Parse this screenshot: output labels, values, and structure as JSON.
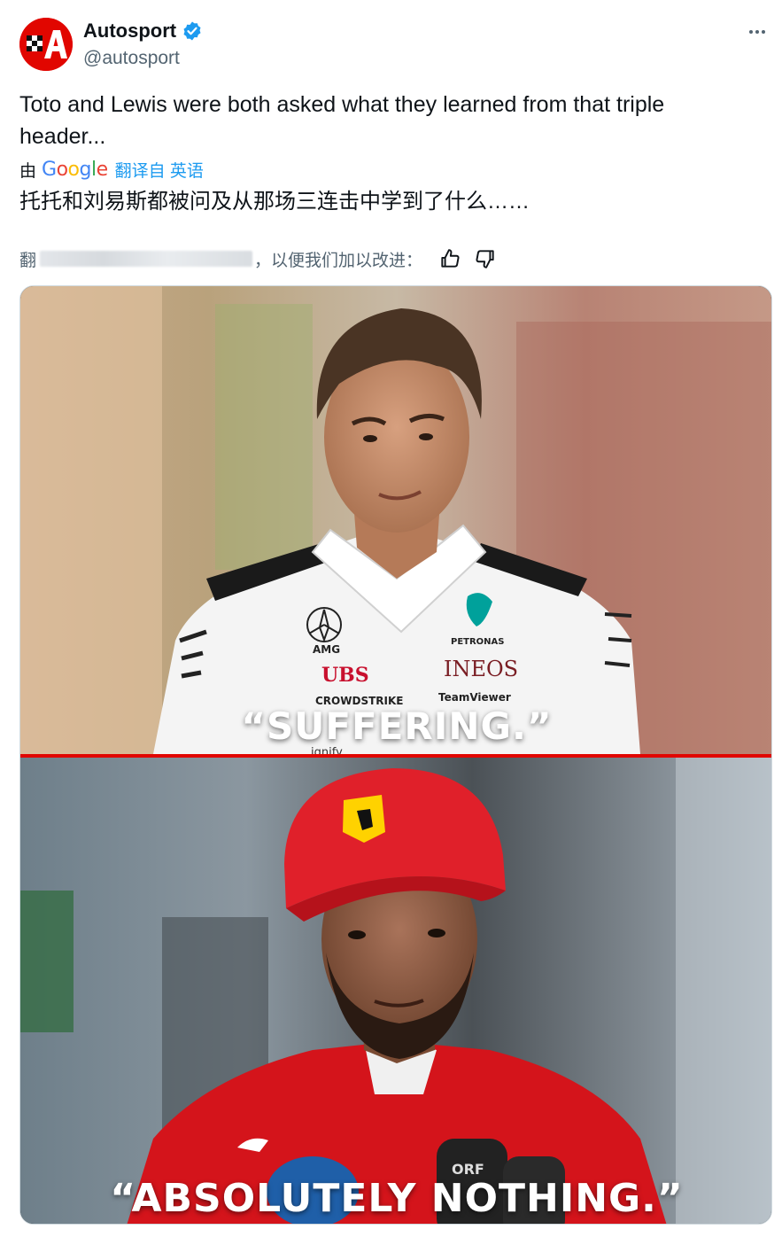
{
  "account": {
    "display_name": "Autosport",
    "handle": "@autosport",
    "avatar_letter": "A",
    "verified": true
  },
  "tweet": {
    "text": "Toto and Lewis were both asked what they learned from that triple header...",
    "translation_by_label": "由",
    "translation_provider": "Google",
    "translated_from_label": "翻译自 英语",
    "translated_text": "托托和刘易斯都被问及从那场三连击中学到了什么……",
    "feedback_prefix": "翻",
    "feedback_suffix": "，以便我们加以改进："
  },
  "media": {
    "top_quote": "“SUFFERING.”",
    "bottom_quote": "“ABSOLUTELY NOTHING.”",
    "shirt_texts": [
      "AMG",
      "UBS",
      "PETRONAS",
      "INEOS",
      "TeamViewer",
      "CROWDSTRIKE",
      "ignify",
      "ORF"
    ]
  },
  "colors": {
    "brand_red": "#e10600",
    "verified_blue": "#1d9bf0",
    "text_primary": "#0f1419",
    "text_secondary": "#536471",
    "ferrari_red": "#d4141b"
  },
  "icons": {
    "more": "more-horizontal-icon",
    "verified": "verified-badge-icon",
    "like_translation": "thumbs-up-icon",
    "dislike_translation": "thumbs-down-icon"
  }
}
